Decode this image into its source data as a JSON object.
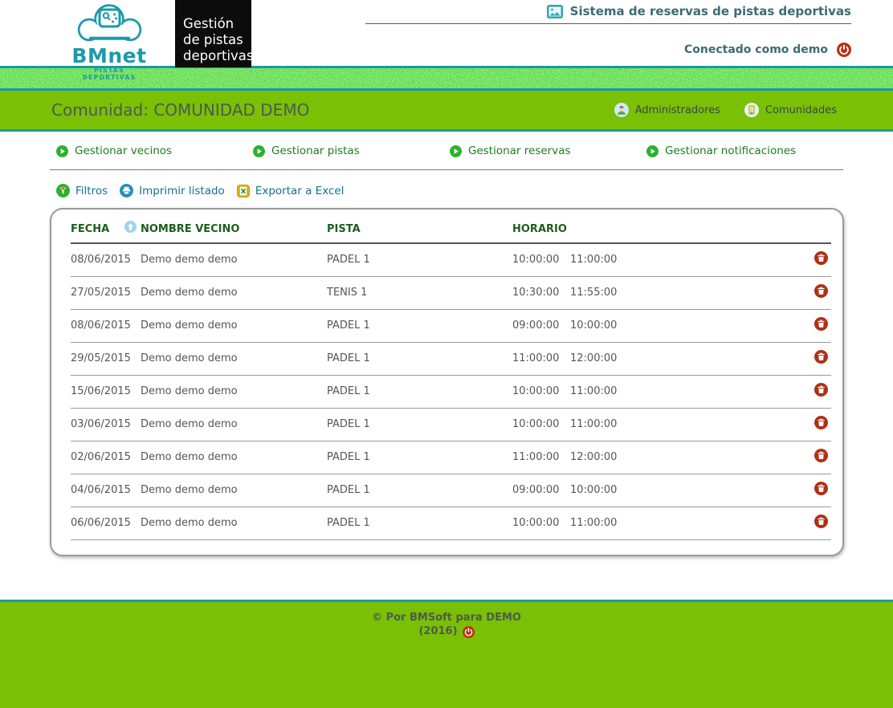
{
  "colors": {
    "brand_teal": "#1b9aaa",
    "border_teal": "#1e97a7",
    "bar_green": "#7ac005",
    "menu_green": "#1e7c1e",
    "link_teal": "#14718c",
    "table_header_green": "#1c5e1c",
    "danger_red": "#b02f15",
    "grass_dark_green": "#46710d"
  },
  "icons": {
    "logo": "cloud-folder-icon",
    "system": "picture-frame-icon",
    "logout": "power-icon",
    "administrators": "person-avatar-icon",
    "communities": "building-icon",
    "menu_bullet": "play-circle-icon",
    "filters": "filter-funnel-circle-icon",
    "print": "printer-circle-icon",
    "export": "excel-file-icon",
    "sort": "sort-up-circle-icon",
    "delete": "trash-circle-icon"
  },
  "header": {
    "logo": {
      "brand": "BMnet",
      "tagline": "PISTAS DEPORTIVAS"
    },
    "app_box": {
      "line1": "Gestión",
      "line2": "de pistas",
      "line3": "deportivas"
    },
    "system_title": "Sistema de reservas de pistas deportivas",
    "connected_as": "Conectado como demo"
  },
  "community_bar": {
    "title": "Comunidad: COMUNIDAD DEMO",
    "admin_label": "Administradores",
    "communities_label": "Comunidades"
  },
  "menu": {
    "items": [
      {
        "label": "Gestionar vecinos"
      },
      {
        "label": "Gestionar pistas"
      },
      {
        "label": "Gestionar reservas"
      },
      {
        "label": "Gestionar notificaciones"
      }
    ]
  },
  "actions": {
    "filters_label": "Filtros",
    "print_label": "Imprimir listado",
    "export_label": "Exportar a Excel"
  },
  "table": {
    "headers": {
      "fecha": "FECHA",
      "nombre": "NOMBRE VECINO",
      "pista": "PISTA",
      "horario": "HORARIO"
    },
    "rows": [
      {
        "fecha": "08/06/2015",
        "nombre": "Demo demo demo",
        "pista": "PADEL 1",
        "inicio": "10:00:00",
        "fin": "11:00:00"
      },
      {
        "fecha": "27/05/2015",
        "nombre": "Demo demo demo",
        "pista": "TENIS 1",
        "inicio": "10:30:00",
        "fin": "11:55:00"
      },
      {
        "fecha": "08/06/2015",
        "nombre": "Demo demo demo",
        "pista": "PADEL 1",
        "inicio": "09:00:00",
        "fin": "10:00:00"
      },
      {
        "fecha": "29/05/2015",
        "nombre": "Demo demo demo",
        "pista": "PADEL 1",
        "inicio": "11:00:00",
        "fin": "12:00:00"
      },
      {
        "fecha": "15/06/2015",
        "nombre": "Demo demo demo",
        "pista": "PADEL 1",
        "inicio": "10:00:00",
        "fin": "11:00:00"
      },
      {
        "fecha": "03/06/2015",
        "nombre": "Demo demo demo",
        "pista": "PADEL 1",
        "inicio": "10:00:00",
        "fin": "11:00:00"
      },
      {
        "fecha": "02/06/2015",
        "nombre": "Demo demo demo",
        "pista": "PADEL 1",
        "inicio": "11:00:00",
        "fin": "12:00:00"
      },
      {
        "fecha": "04/06/2015",
        "nombre": "Demo demo demo",
        "pista": "PADEL 1",
        "inicio": "09:00:00",
        "fin": "10:00:00"
      },
      {
        "fecha": "06/06/2015",
        "nombre": "Demo demo demo",
        "pista": "PADEL 1",
        "inicio": "10:00:00",
        "fin": "11:00:00"
      }
    ]
  },
  "footer": {
    "line1": "© Por BMSoft para DEMO",
    "line2": "(2016)"
  }
}
